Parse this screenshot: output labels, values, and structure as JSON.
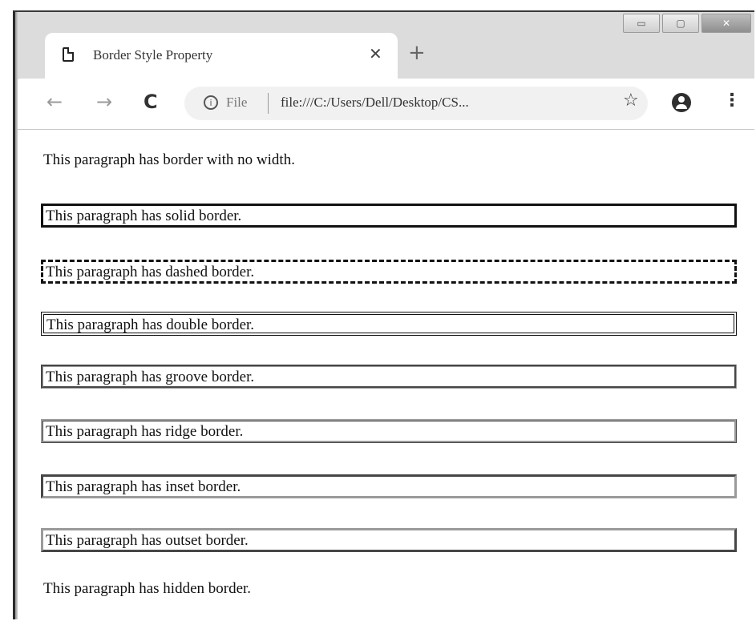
{
  "browser": {
    "tab_title": "Border Style Property",
    "tab_close_icon": "close-icon",
    "new_tab_icon": "plus-icon",
    "nav": {
      "back_icon": "arrow-left-icon",
      "forward_icon": "arrow-right-icon",
      "reload_icon": "reload-icon"
    },
    "address": {
      "scheme_label": "File",
      "url": "file:///C:/Users/Dell/Desktop/CS..."
    },
    "bookmark_icon": "star-icon",
    "profile_icon": "account-icon",
    "menu_icon": "more-vert-icon"
  },
  "paragraphs": [
    {
      "text": "This paragraph has border with no width.",
      "style": "none"
    },
    {
      "text": "This paragraph has solid border.",
      "style": "solid"
    },
    {
      "text": "This paragraph has dashed border.",
      "style": "dashed"
    },
    {
      "text": "This paragraph has double border.",
      "style": "double"
    },
    {
      "text": "This paragraph has groove border.",
      "style": "groove"
    },
    {
      "text": "This paragraph has ridge border.",
      "style": "ridge"
    },
    {
      "text": "This paragraph has inset border.",
      "style": "inset"
    },
    {
      "text": "This paragraph has outset border.",
      "style": "outset"
    },
    {
      "text": "This paragraph has hidden border.",
      "style": "hidden"
    }
  ]
}
